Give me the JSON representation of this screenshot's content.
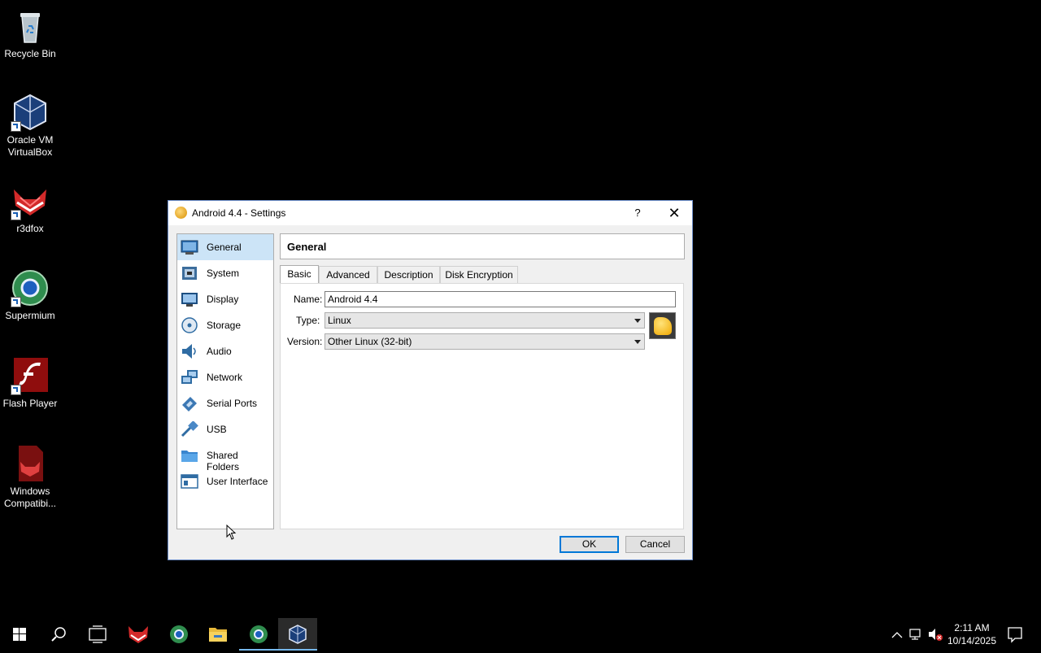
{
  "desktop": {
    "icons": [
      {
        "label": "Recycle Bin",
        "icon": "recycle-bin-icon"
      },
      {
        "label": "Oracle VM VirtualBox",
        "icon": "virtualbox-icon"
      },
      {
        "label": "r3dfox",
        "icon": "r3dfox-icon"
      },
      {
        "label": "Supermium",
        "icon": "supermium-icon"
      },
      {
        "label": "Flash Player",
        "icon": "flash-player-icon"
      },
      {
        "label": "Windows Compatibi...",
        "icon": "windows-compat-icon"
      }
    ]
  },
  "dialog": {
    "title": "Android 4.4 - Settings",
    "help_label": "?",
    "close_label": "✕",
    "nav": [
      {
        "label": "General",
        "icon": "general-icon",
        "active": true
      },
      {
        "label": "System",
        "icon": "system-icon"
      },
      {
        "label": "Display",
        "icon": "display-icon"
      },
      {
        "label": "Storage",
        "icon": "storage-icon"
      },
      {
        "label": "Audio",
        "icon": "audio-icon"
      },
      {
        "label": "Network",
        "icon": "network-icon"
      },
      {
        "label": "Serial Ports",
        "icon": "serial-ports-icon"
      },
      {
        "label": "USB",
        "icon": "usb-icon"
      },
      {
        "label": "Shared Folders",
        "icon": "shared-folders-icon"
      },
      {
        "label": "User Interface",
        "icon": "user-interface-icon"
      }
    ],
    "section_title": "General",
    "tabs": [
      "Basic",
      "Advanced",
      "Description",
      "Disk Encryption"
    ],
    "active_tab": "Basic",
    "form": {
      "name_label": "Name:",
      "name_value": "Android 4.4",
      "type_label": "Type:",
      "type_value": "Linux",
      "version_label": "Version:",
      "version_value": "Other Linux (32-bit)"
    },
    "ok_label": "OK",
    "cancel_label": "Cancel"
  },
  "taskbar": {
    "items": [
      "start-icon",
      "search-icon",
      "task-view-icon",
      "r3dfox-icon",
      "supermium-icon",
      "file-explorer-icon",
      "supermium-active-icon",
      "virtualbox-icon"
    ],
    "clock_time": "2:11 AM",
    "clock_date": "10/14/2025"
  }
}
